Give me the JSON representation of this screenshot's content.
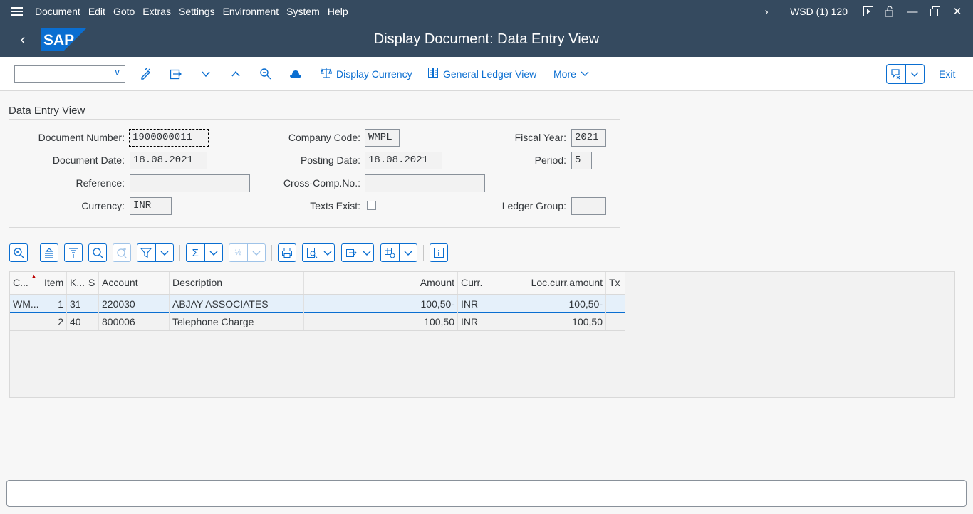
{
  "menubar": {
    "items": [
      "Document",
      "Edit",
      "Goto",
      "Extras",
      "Settings",
      "Environment",
      "System",
      "Help"
    ],
    "system_info": "WSD (1) 120"
  },
  "titlebar": {
    "title": "Display Document: Data Entry View",
    "logo_text": "SAP"
  },
  "toolbar": {
    "combo_value": "",
    "display_currency": "Display Currency",
    "general_ledger_view": "General Ledger View",
    "more": "More",
    "exit": "Exit"
  },
  "section_title": "Data Entry View",
  "form": {
    "document_number_label": "Document Number:",
    "document_number": "1900000011",
    "company_code_label": "Company Code:",
    "company_code": "WMPL",
    "fiscal_year_label": "Fiscal Year:",
    "fiscal_year": "2021",
    "document_date_label": "Document Date:",
    "document_date": "18.08.2021",
    "posting_date_label": "Posting Date:",
    "posting_date": "18.08.2021",
    "period_label": "Period:",
    "period": "5",
    "reference_label": "Reference:",
    "reference": "",
    "cross_comp_label": "Cross-Comp.No.:",
    "cross_comp": "",
    "currency_label": "Currency:",
    "currency": "INR",
    "texts_exist_label": "Texts Exist:",
    "ledger_group_label": "Ledger Group:",
    "ledger_group": ""
  },
  "grid": {
    "columns": [
      "C...",
      "Item",
      "K...",
      "S",
      "Account",
      "Description",
      "Amount",
      "Curr.",
      "Loc.curr.amount",
      "Tx"
    ],
    "rows": [
      {
        "c": "WM...",
        "item": "1",
        "k": "31",
        "s": "",
        "account": "220030",
        "description": "ABJAY ASSOCIATES",
        "amount": "100,50-",
        "curr": "INR",
        "loc_amount": "100,50-",
        "tx": ""
      },
      {
        "c": "",
        "item": "2",
        "k": "40",
        "s": "",
        "account": "800006",
        "description": "Telephone Charge",
        "amount": "100,50",
        "curr": "INR",
        "loc_amount": "100,50",
        "tx": ""
      }
    ]
  },
  "status_bar": {
    "message": ""
  }
}
